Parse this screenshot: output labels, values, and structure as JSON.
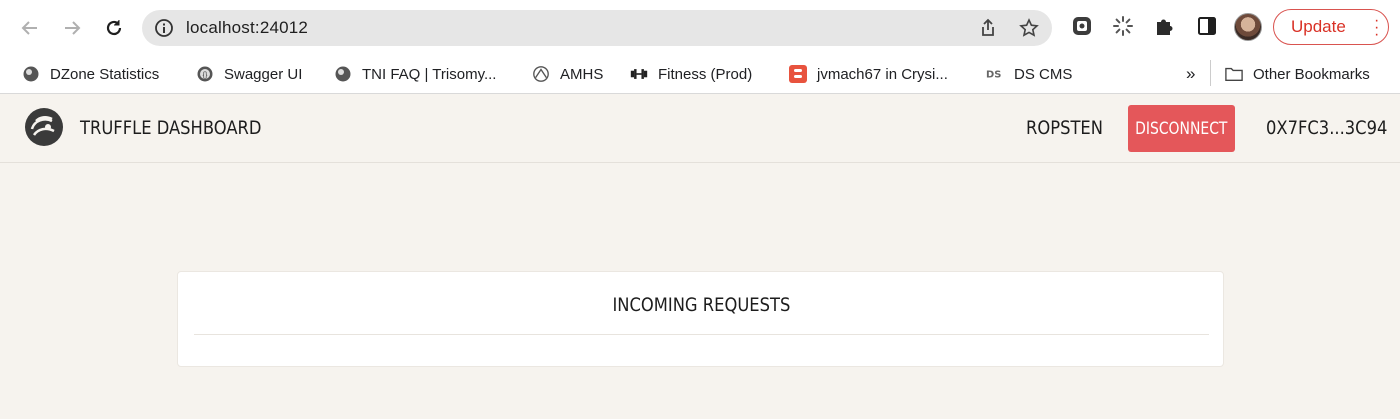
{
  "browser": {
    "url": "localhost:24012",
    "update_label": "Update",
    "bookmarks": [
      {
        "label": "DZone Statistics",
        "icon": "globe-icon"
      },
      {
        "label": "Swagger UI",
        "icon": "swagger-icon"
      },
      {
        "label": "TNI FAQ | Trisomy...",
        "icon": "globe-icon"
      },
      {
        "label": "AMHS",
        "icon": "amhs-icon"
      },
      {
        "label": "Fitness (Prod)",
        "icon": "dumbbell-icon"
      },
      {
        "label": "jvmach67 in Crysi...",
        "icon": "blogger-icon"
      },
      {
        "label": "DS CMS",
        "icon": "ds-icon"
      }
    ],
    "overflow_label": "»",
    "other_bookmarks_label": "Other Bookmarks"
  },
  "app": {
    "title": "TRUFFLE DASHBOARD",
    "network": "ROPSTEN",
    "disconnect_label": "DISCONNECT",
    "account": "0X7FC3...3C94"
  },
  "main": {
    "card_title": "INCOMING REQUESTS"
  },
  "colors": {
    "accent": "#e4575a",
    "page_background": "#f6f3ee",
    "update_text": "#d93025"
  }
}
